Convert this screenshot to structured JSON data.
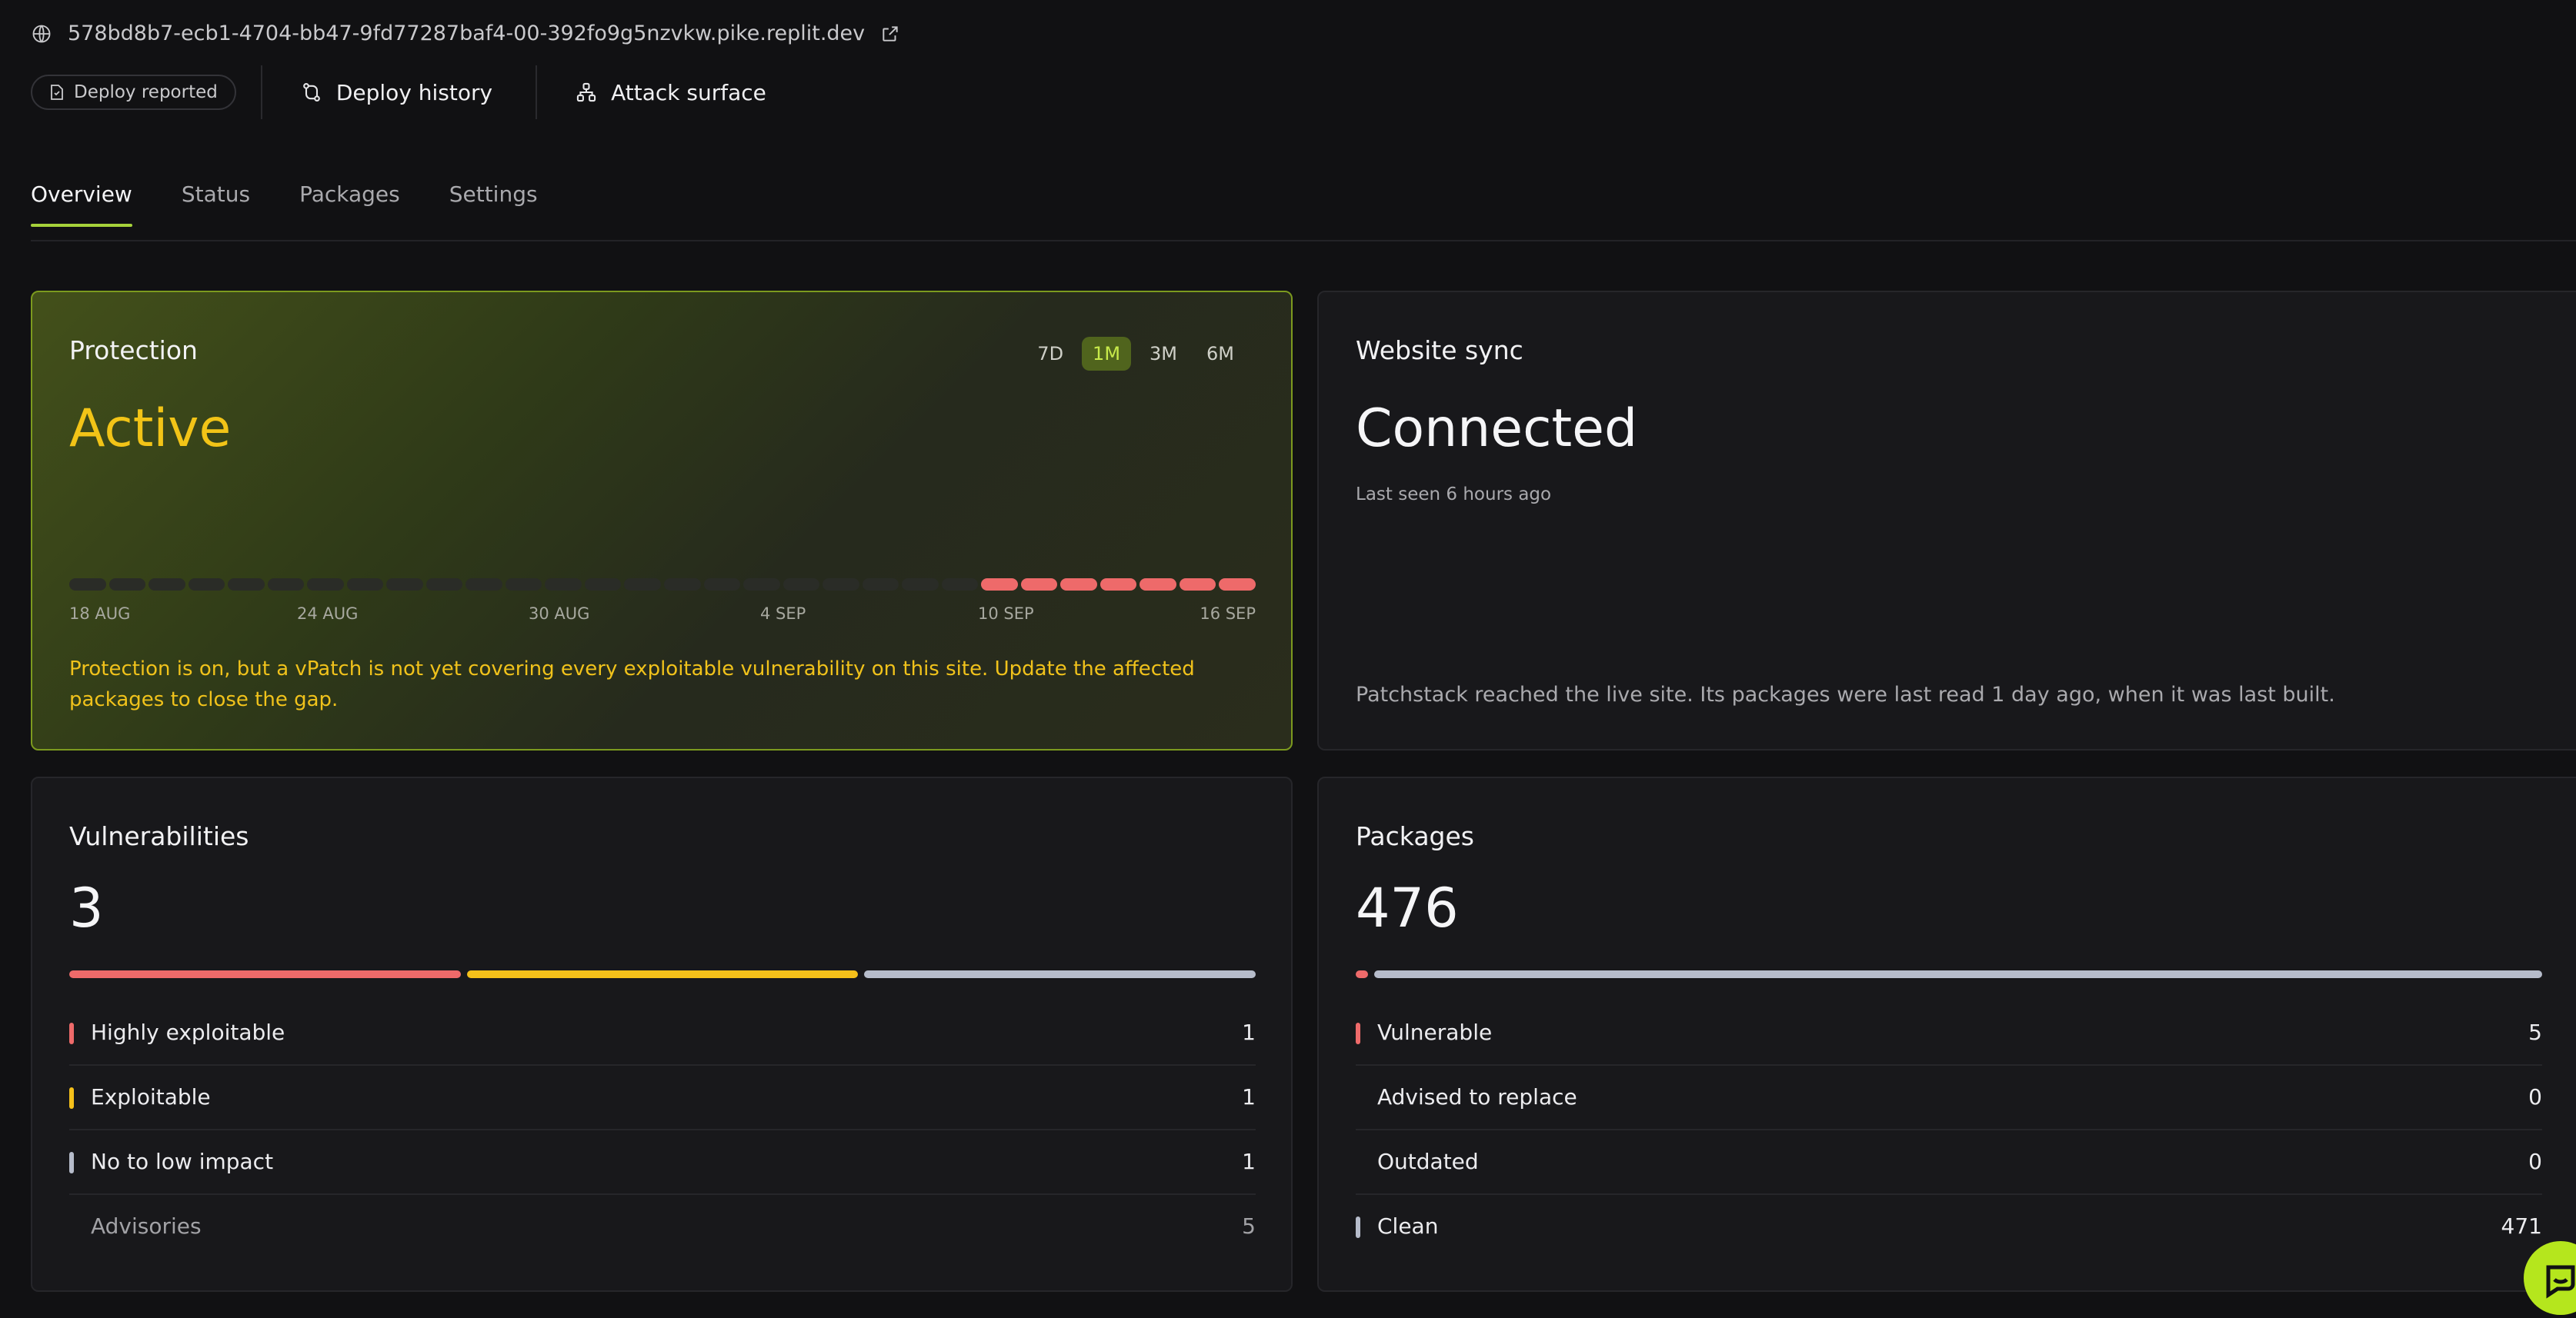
{
  "header": {
    "url": "578bd8b7-ecb1-4704-bb47-9fd77287baf4-00-392fo9g5nzvkw.pike.replit.dev",
    "chip_label": "Deploy reported",
    "deploy_history": "Deploy history",
    "attack_surface": "Attack surface"
  },
  "tabs": [
    {
      "label": "Overview",
      "active": true
    },
    {
      "label": "Status",
      "active": false
    },
    {
      "label": "Packages",
      "active": false
    },
    {
      "label": "Settings",
      "active": false
    }
  ],
  "protection": {
    "title": "Protection",
    "status": "Active",
    "ranges": [
      "7D",
      "1M",
      "3M",
      "6M"
    ],
    "selected_range": "1M",
    "timeline": {
      "days": 30,
      "red_from_index": 23,
      "dates": [
        "18 AUG",
        "24 AUG",
        "30 AUG",
        "4 SEP",
        "10 SEP",
        "16 SEP"
      ]
    },
    "note": "Protection is on, but a vPatch is not yet covering every exploitable vulnerability on this site. Update the affected packages to close the gap."
  },
  "sync": {
    "title": "Website sync",
    "status": "Connected",
    "last_seen": "Last seen 6 hours ago",
    "description": "Patchstack reached the live site. Its packages were last read 1 day ago, when it was last built."
  },
  "vulnerabilities": {
    "title": "Vulnerabilities",
    "count": "3",
    "rows": [
      {
        "label": "Highly exploitable",
        "value": "1",
        "color": "#ee6a6a"
      },
      {
        "label": "Exploitable",
        "value": "1",
        "color": "#f5c01a"
      },
      {
        "label": "No to low impact",
        "value": "1",
        "color": "#b6bccb"
      },
      {
        "label": "Advisories",
        "value": "5",
        "color": ""
      }
    ]
  },
  "packages": {
    "title": "Packages",
    "count": "476",
    "rows": [
      {
        "label": "Vulnerable",
        "value": "5",
        "color": "#ee6a6a"
      },
      {
        "label": "Advised to replace",
        "value": "0",
        "color": ""
      },
      {
        "label": "Outdated",
        "value": "0",
        "color": ""
      },
      {
        "label": "Clean",
        "value": "471",
        "color": "#b6bccb"
      }
    ]
  },
  "colors": {
    "accent": "#a6d23a",
    "active_yellow": "#f2c417",
    "danger": "#ee6a6a",
    "warning": "#f5c01a",
    "neutral": "#b6bccb"
  }
}
